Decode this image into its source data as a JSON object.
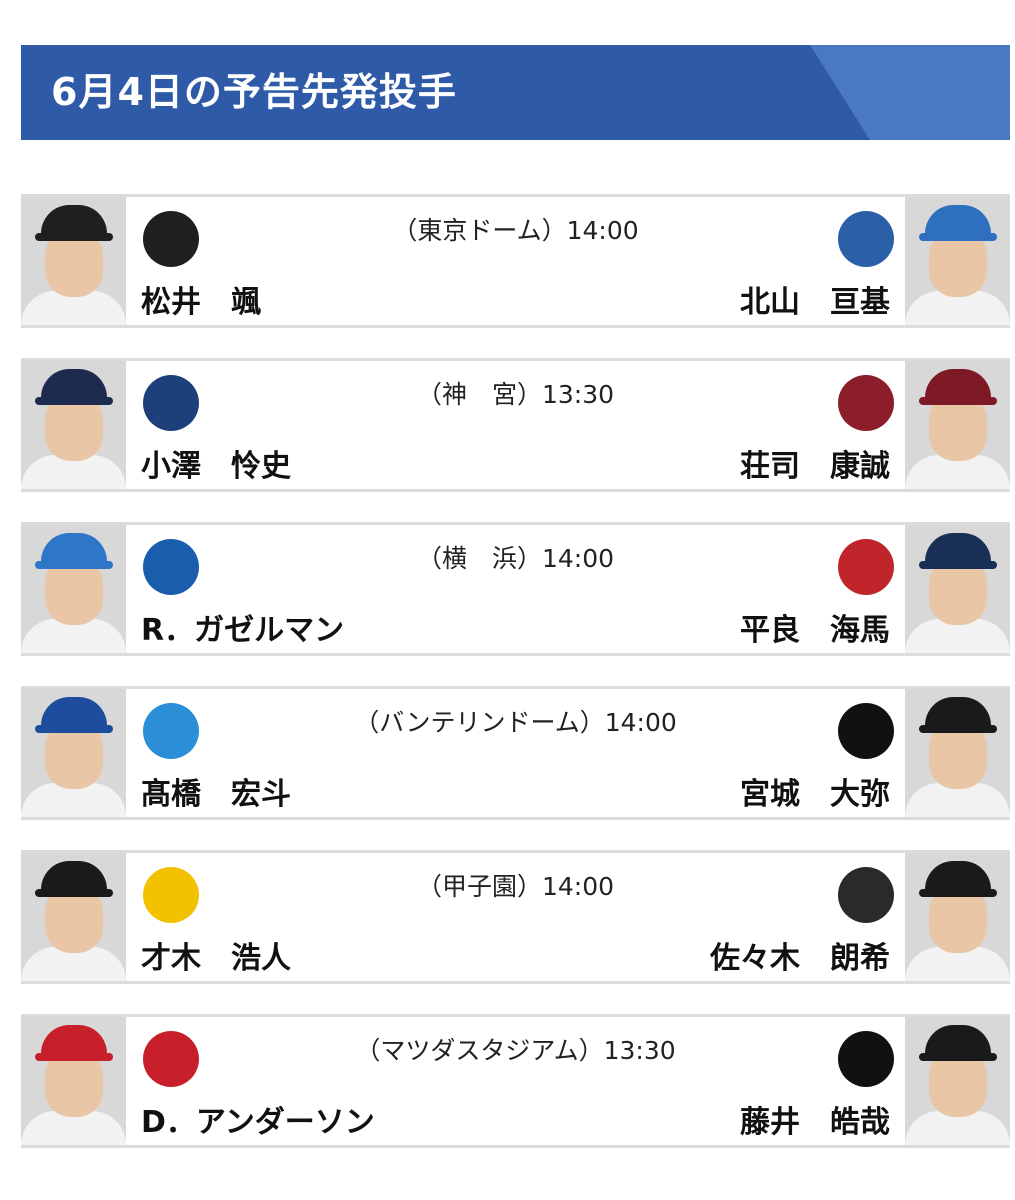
{
  "header": {
    "title": "6月4日の予告先発投手"
  },
  "games": [
    {
      "venue": "（東京ドーム）14:00",
      "home": {
        "pitcher": "松井　颯",
        "team_logo": "giants-logo",
        "logo_color": "#1f1f1f",
        "cap_color": "#1f1f1f"
      },
      "away": {
        "pitcher": "北山　亘基",
        "team_logo": "fighters-logo",
        "logo_color": "#2b5fa8",
        "cap_color": "#2f6fc0"
      }
    },
    {
      "venue": "（神　宮）13:30",
      "home": {
        "pitcher": "小澤　怜史",
        "team_logo": "swallows-logo",
        "logo_color": "#1d3f7a",
        "cap_color": "#1d2b4f"
      },
      "away": {
        "pitcher": "荘司　康誠",
        "team_logo": "eagles-logo",
        "logo_color": "#8c1d2a",
        "cap_color": "#7d1a25"
      }
    },
    {
      "venue": "（横　浜）14:00",
      "home": {
        "pitcher": "R．ガゼルマン",
        "team_logo": "baystars-logo",
        "logo_color": "#1b5dad",
        "cap_color": "#2d76c8"
      },
      "away": {
        "pitcher": "平良　海馬",
        "team_logo": "lions-logo",
        "logo_color": "#c0252c",
        "cap_color": "#1a2f55"
      }
    },
    {
      "venue": "（バンテリンドーム）14:00",
      "home": {
        "pitcher": "髙橋　宏斗",
        "team_logo": "dragons-logo",
        "logo_color": "#2a8fd6",
        "cap_color": "#1d4d9c"
      },
      "away": {
        "pitcher": "宮城　大弥",
        "team_logo": "buffaloes-logo",
        "logo_color": "#111111",
        "cap_color": "#1a1a1a"
      }
    },
    {
      "venue": "（甲子園）14:00",
      "home": {
        "pitcher": "才木　浩人",
        "team_logo": "tigers-logo",
        "logo_color": "#f2c200",
        "cap_color": "#1a1a1a"
      },
      "away": {
        "pitcher": "佐々木　朗希",
        "team_logo": "marines-logo",
        "logo_color": "#2a2a2a",
        "cap_color": "#1a1a1a"
      }
    },
    {
      "venue": "（マツダスタジアム）13:30",
      "home": {
        "pitcher": "D．アンダーソン",
        "team_logo": "carp-logo",
        "logo_color": "#c8202b",
        "cap_color": "#c8202b"
      },
      "away": {
        "pitcher": "藤井　皓哉",
        "team_logo": "hawks-logo",
        "logo_color": "#111111",
        "cap_color": "#1a1a1a"
      }
    }
  ]
}
